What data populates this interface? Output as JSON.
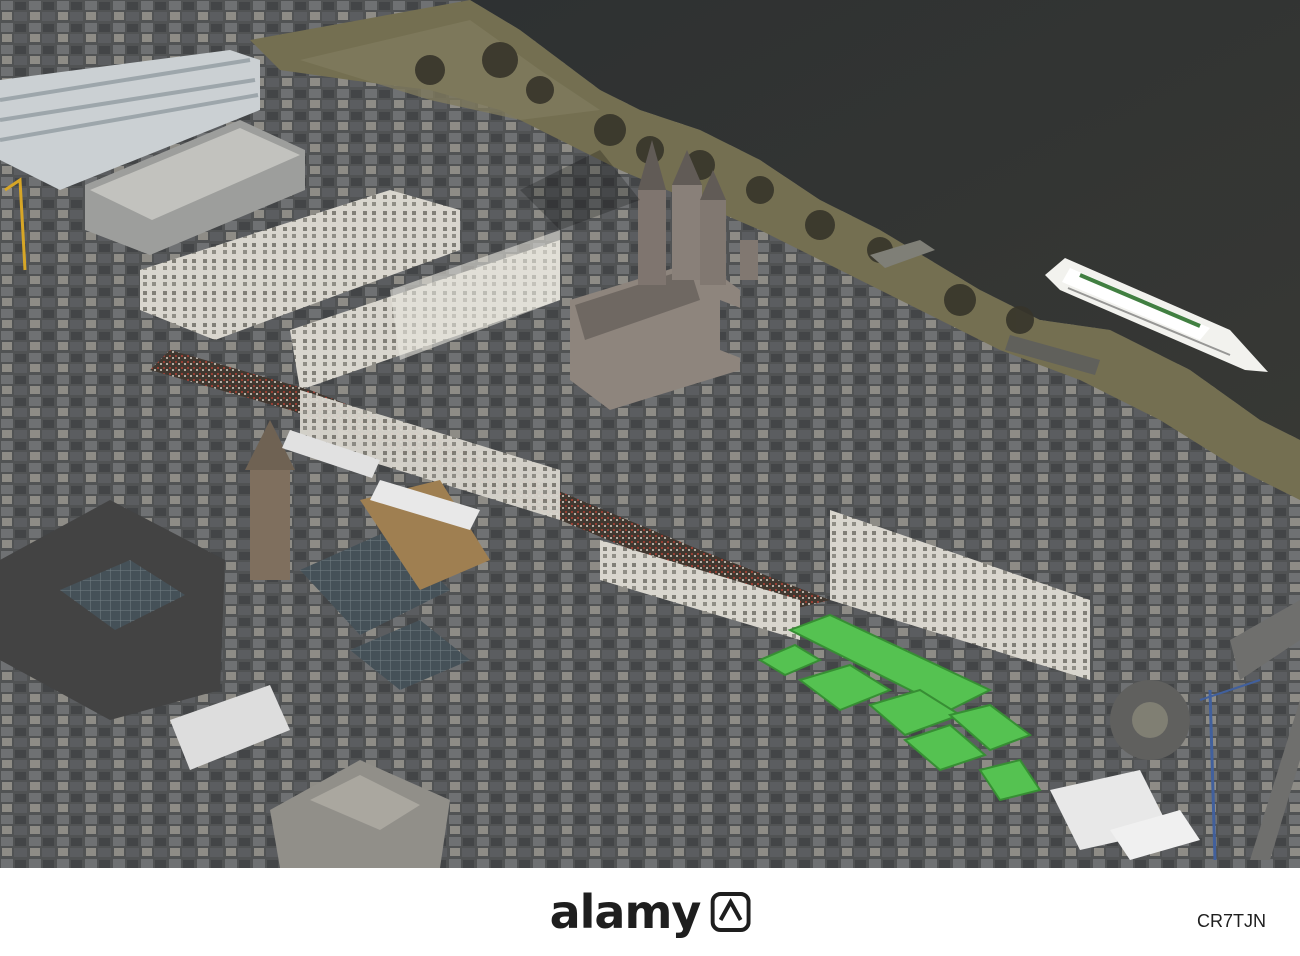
{
  "image": {
    "type": "aerial-photograph",
    "scene_elements": [
      "river",
      "church-towers",
      "old-town-rooftops",
      "riverside-promenade",
      "passenger-ship",
      "market-stalls",
      "crowds",
      "town-hall-tower"
    ]
  },
  "watermark": {
    "brand": "alamy",
    "stock_id": "CR7TJN"
  },
  "colors": {
    "river": "#2a2b28",
    "roofs": "#5a5c5e",
    "facades": "#d9d6cf",
    "stalls": "#4fc04a",
    "promenade": "#6f6a4a"
  }
}
